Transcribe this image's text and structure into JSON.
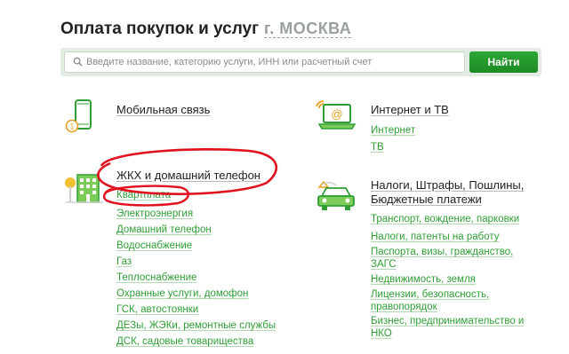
{
  "header": {
    "title": "Оплата покупок и услуг",
    "city": "г. МОСКВА"
  },
  "search": {
    "placeholder": "Введите название, категорию услуги, ИНН или расчетный счет",
    "value": "",
    "button_label": "Найти"
  },
  "left_column": [
    {
      "name": "Мобильная связь",
      "icon": "mobile-phone-icon",
      "items": []
    },
    {
      "name": "ЖКХ и домашний телефон",
      "icon": "apartment-building-icon",
      "items": [
        "Квартплата",
        "Электроэнергия",
        "Домашний телефон",
        "Водоснабжение",
        "Газ",
        "Теплоснабжение",
        "Охранные услуги, домофон",
        "ГСК, автостоянки",
        "ДЕЗы, ЖЭКи, ремонтные службы",
        "ДСК, садовые товарищества"
      ]
    }
  ],
  "right_column": [
    {
      "name": "Интернет и ТВ",
      "icon": "laptop-wifi-icon",
      "items": [
        "Интернет",
        "ТВ"
      ]
    },
    {
      "name": "Налоги, Штрафы, Пошлины, Бюджетные платежи",
      "icon": "car-taxes-icon",
      "items": [
        "Транспорт, вождение, парковки",
        "Налоги, патенты на работу",
        "Паспорта, визы, гражданство, ЗАГС",
        "Недвижимость, земля",
        "Лицензии, безопасность, правопорядок",
        "Бизнес, предпринимательство и НКО"
      ]
    }
  ],
  "colors": {
    "accent": "#2f9e35",
    "button": "#21922a",
    "annotation": "#e0101e"
  }
}
